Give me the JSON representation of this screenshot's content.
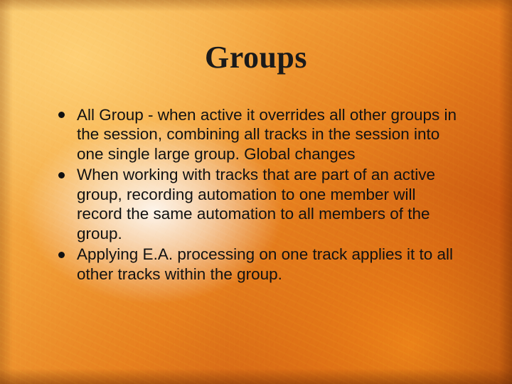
{
  "title": "Groups",
  "bullets": [
    "All Group - when active it overrides all other groups in the session, combining all tracks in the session into one single large group. Global changes",
    "When working with tracks that are part of an active group, recording automation to one member will record the same automation to all members of the group.",
    "Applying E.A. processing on one track applies it to all other tracks within the group."
  ]
}
